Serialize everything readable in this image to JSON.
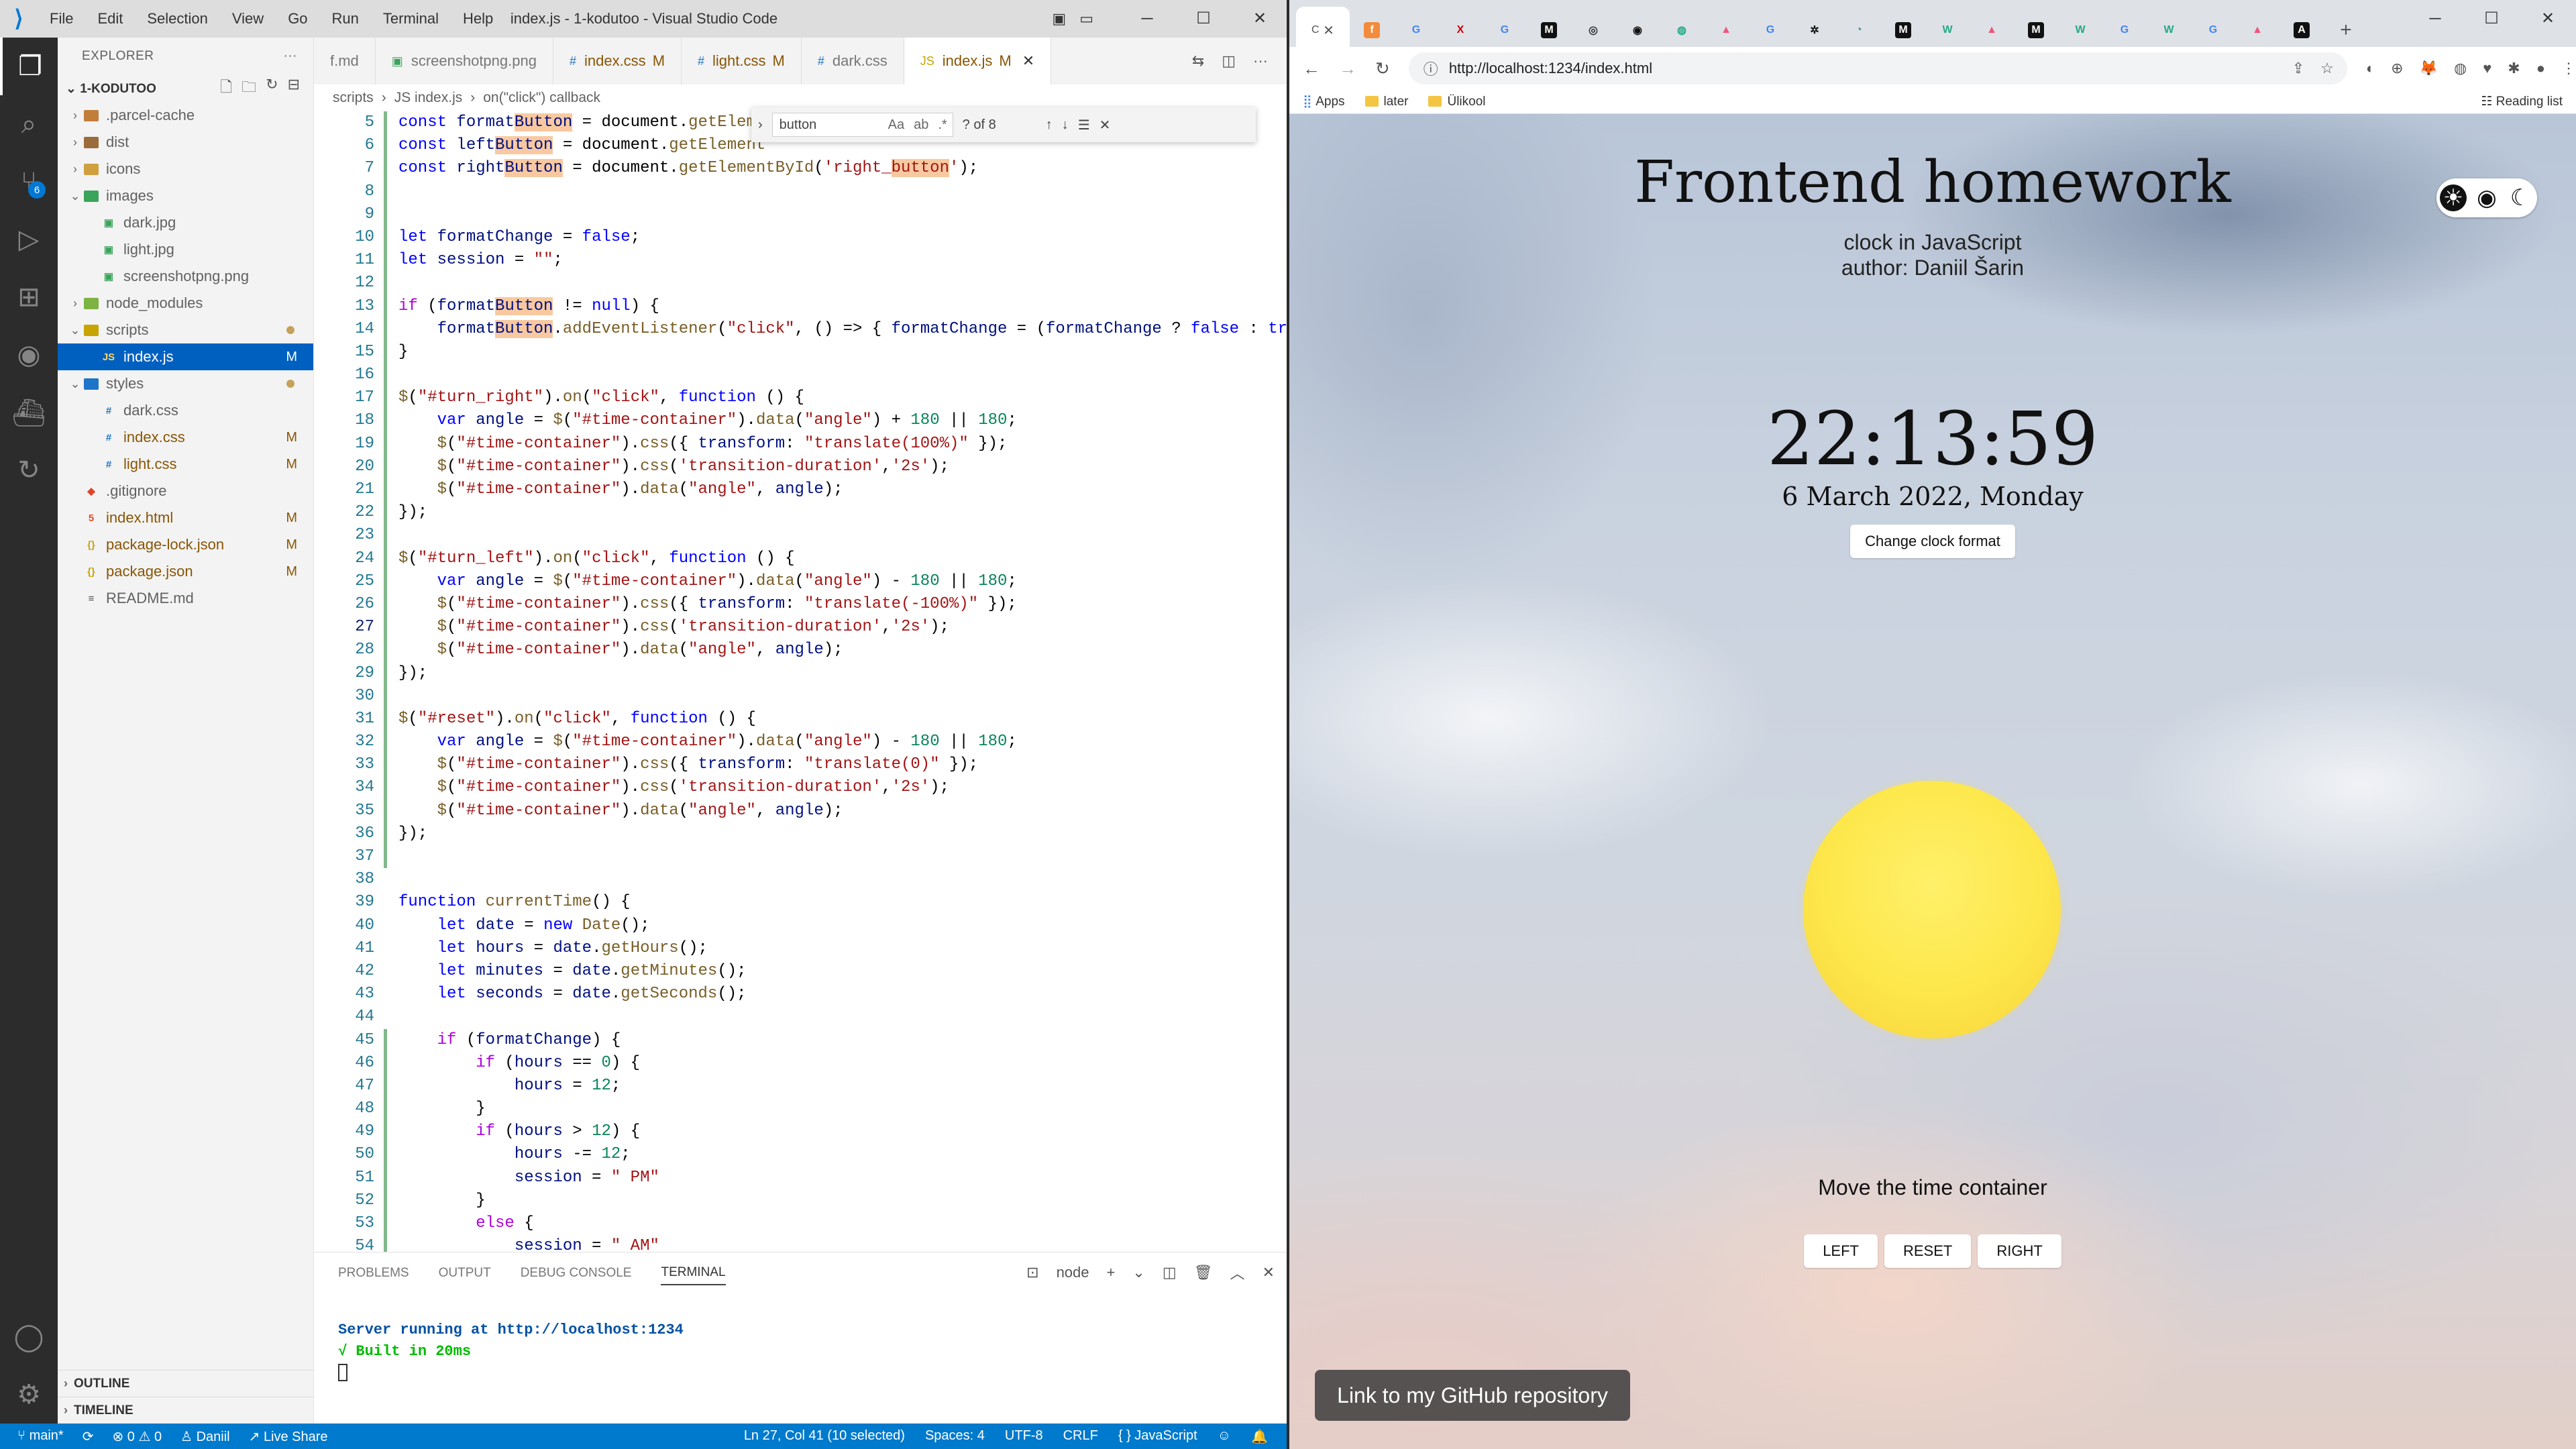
{
  "vscode": {
    "menu": [
      "File",
      "Edit",
      "Selection",
      "View",
      "Go",
      "Run",
      "Terminal",
      "Help"
    ],
    "window_title": "index.js - 1-kodutoo - Visual Studio Code",
    "explorer_label": "EXPLORER",
    "project": "1-KODUTOO",
    "tree": [
      {
        "label": ".parcel-cache",
        "kind": "folder",
        "indent": 1
      },
      {
        "label": "dist",
        "kind": "folder",
        "indent": 1
      },
      {
        "label": "icons",
        "kind": "folder",
        "indent": 1
      },
      {
        "label": "images",
        "kind": "folder-open",
        "indent": 1
      },
      {
        "label": "dark.jpg",
        "kind": "img",
        "indent": 2
      },
      {
        "label": "light.jpg",
        "kind": "img",
        "indent": 2
      },
      {
        "label": "screenshotpng.png",
        "kind": "img",
        "indent": 2
      },
      {
        "label": "node_modules",
        "kind": "folder",
        "indent": 1
      },
      {
        "label": "scripts",
        "kind": "folder-open",
        "indent": 1,
        "dot": true
      },
      {
        "label": "index.js",
        "kind": "js",
        "indent": 2,
        "status": "M",
        "selected": true
      },
      {
        "label": "styles",
        "kind": "folder-open",
        "indent": 1,
        "dot": true
      },
      {
        "label": "dark.css",
        "kind": "css",
        "indent": 2
      },
      {
        "label": "index.css",
        "kind": "css",
        "indent": 2,
        "status": "M"
      },
      {
        "label": "light.css",
        "kind": "css",
        "indent": 2,
        "status": "M"
      },
      {
        "label": ".gitignore",
        "kind": "git",
        "indent": 1
      },
      {
        "label": "index.html",
        "kind": "html",
        "indent": 1,
        "status": "M"
      },
      {
        "label": "package-lock.json",
        "kind": "json",
        "indent": 1,
        "status": "M"
      },
      {
        "label": "package.json",
        "kind": "json",
        "indent": 1,
        "status": "M"
      },
      {
        "label": "README.md",
        "kind": "md",
        "indent": 1
      }
    ],
    "outline_label": "OUTLINE",
    "timeline_label": "TIMELINE",
    "scm_badge": "6",
    "tabs": [
      {
        "label": "f.md",
        "icon": "",
        "mod": ""
      },
      {
        "label": "screenshotpng.png",
        "icon": "img",
        "mod": ""
      },
      {
        "label": "index.css",
        "icon": "css",
        "mod": "M"
      },
      {
        "label": "light.css",
        "icon": "css",
        "mod": "M"
      },
      {
        "label": "dark.css",
        "icon": "css",
        "mod": ""
      },
      {
        "label": "index.js",
        "icon": "js",
        "mod": "M",
        "active": true
      }
    ],
    "breadcrumb": [
      "scripts",
      "JS index.js",
      "on(\"click\") callback"
    ],
    "find": {
      "value": "button",
      "count": "? of 8"
    },
    "panel_tabs": [
      "PROBLEMS",
      "OUTPUT",
      "DEBUG CONSOLE",
      "TERMINAL"
    ],
    "panel_active": "TERMINAL",
    "terminal_shell": "node",
    "terminal_lines": [
      "Server running at http://localhost:1234",
      "√ Built in 20ms"
    ],
    "status": {
      "branch": "main*",
      "errors": "⊗ 0 ⚠ 0",
      "user": "Daniil",
      "live_share": "Live Share",
      "position": "Ln 27, Col 41 (10 selected)",
      "spaces": "Spaces: 4",
      "encoding": "UTF-8",
      "eol": "CRLF",
      "language": "{ } JavaScript"
    }
  },
  "browser": {
    "url": "http://localhost:1234/index.html",
    "bookmarks": [
      "Apps",
      "later",
      "Ülikool"
    ],
    "reading_list": "Reading list",
    "page": {
      "title": "Frontend homework",
      "subtitle1": "clock in JavaScript",
      "subtitle2": "author: Daniil Šarin",
      "time": "22:13:59",
      "date": "6 March 2022, Monday",
      "format_button": "Change clock format",
      "move_label": "Move the time container",
      "left": "LEFT",
      "reset": "RESET",
      "right": "RIGHT",
      "github": "Link to my GitHub repository"
    }
  }
}
